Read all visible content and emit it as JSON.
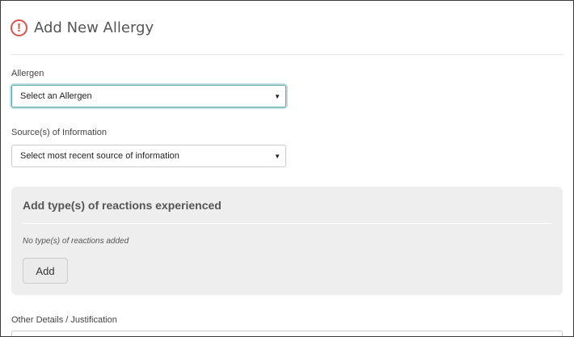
{
  "header": {
    "title": "Add New Allergy",
    "icon": "alert-circle-icon",
    "icon_glyph": "!",
    "accent": "#d9534f"
  },
  "allergen": {
    "label": "Allergen",
    "selected": "Select an Allergen",
    "caret": "▼"
  },
  "source": {
    "label": "Source(s) of Information",
    "selected": "Select most recent source of information",
    "caret": "▼"
  },
  "reactions": {
    "title": "Add type(s) of reactions experienced",
    "empty_text": "No type(s) of reactions added",
    "add_label": "Add"
  },
  "other": {
    "label": "Other Details / Justification",
    "value": ""
  }
}
